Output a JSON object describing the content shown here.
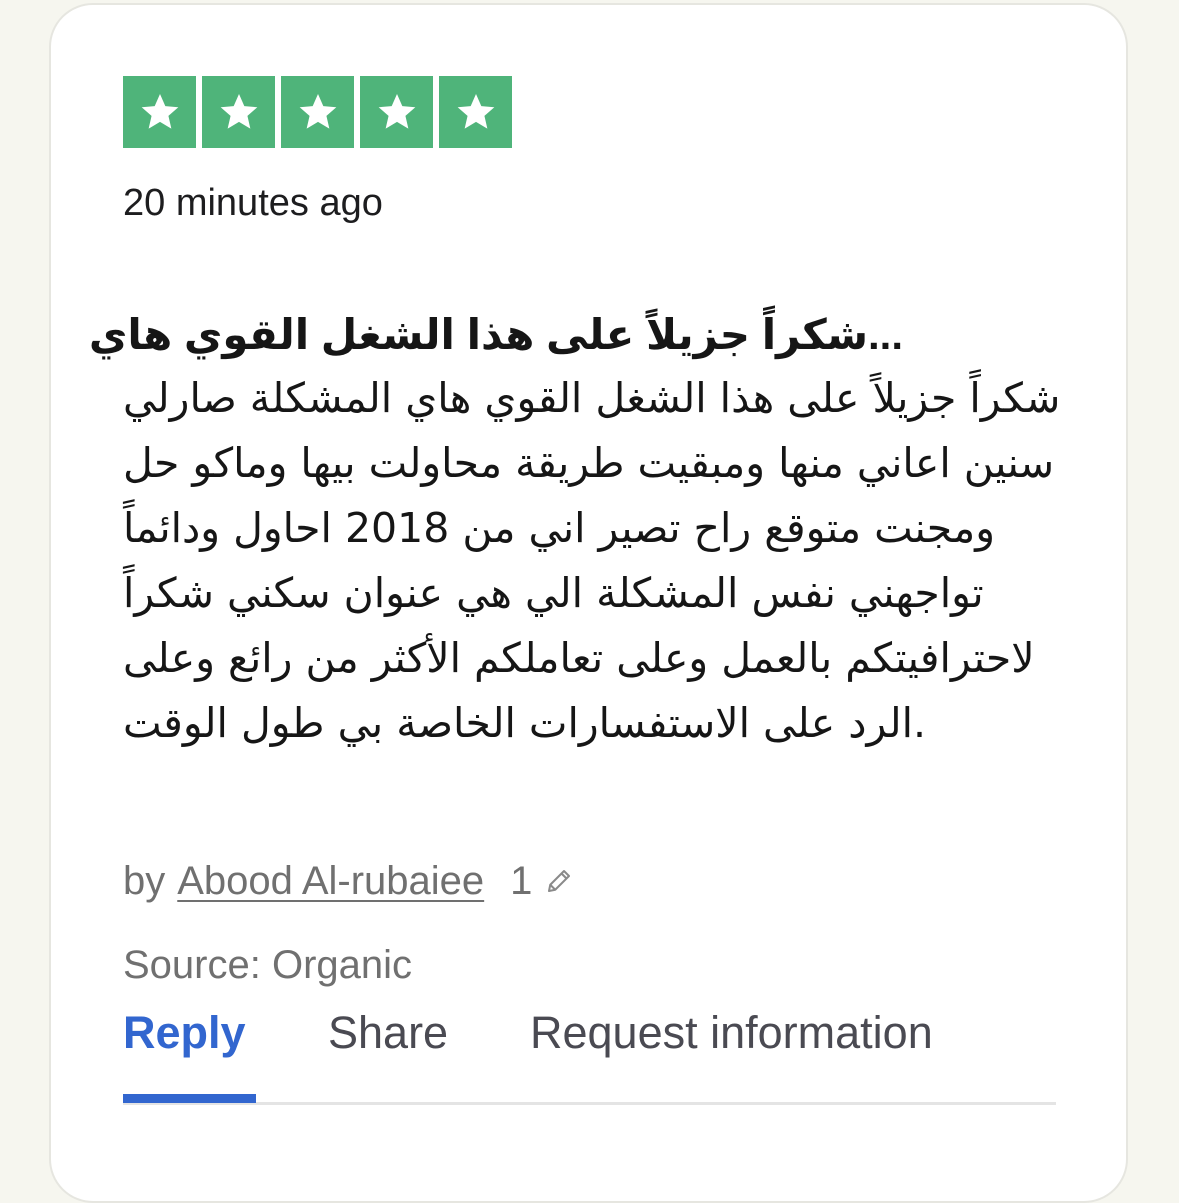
{
  "rating": {
    "stars": 5,
    "max_stars": 5,
    "color": "#4fb47a"
  },
  "review": {
    "time": "20 minutes ago",
    "title": "...شكراً جزيلاً على هذا الشغل القوي هاي",
    "body_lines": [
      "شكراً جزيلاً على هذا الشغل القوي هاي المشكلة صارلي",
      "سنين اعاني منها ومبقيت طريقة محاولت بيها وماكو حل",
      "ومجنت متوقع راح تصير اني من 2018 احاول ودائماً",
      "تواجهني نفس المشكلة الي هي عنوان سكني شكراً",
      "لاحترافيتكم بالعمل وعلى تعاملكم الأكثر من رائع وعلى",
      ".الرد على الاستفسارات الخاصة بي طول الوقت"
    ]
  },
  "byline": {
    "prefix": "by",
    "author": "Abood Al-rubaiee",
    "review_count": "1",
    "icon": "pencil-icon"
  },
  "source": "Source: Organic",
  "tabs": [
    {
      "label": "Reply",
      "active": true
    },
    {
      "label": "Share",
      "active": false
    },
    {
      "label": "Request information",
      "active": false
    }
  ],
  "colors": {
    "accent": "#3266cf",
    "muted": "#707070",
    "star_green": "#4fb47a"
  }
}
